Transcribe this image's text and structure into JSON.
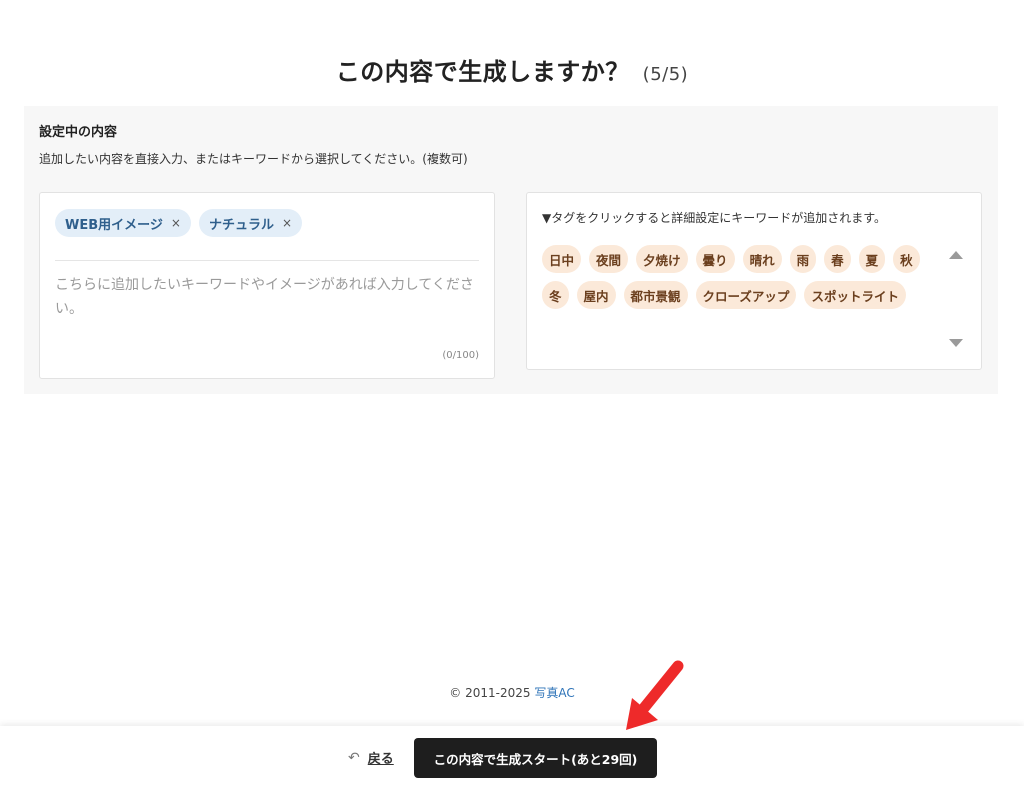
{
  "header": {
    "title": "この内容で生成しますか？",
    "step": "(5/5)"
  },
  "settings": {
    "section_title": "設定中の内容",
    "description": "追加したい内容を直接入力、またはキーワードから選択してください。(複数可)",
    "selected_chips": [
      {
        "label": "WEB用イメージ",
        "remove": "×"
      },
      {
        "label": "ナチュラル",
        "remove": "×"
      }
    ],
    "keyword_input": {
      "value": "",
      "placeholder": "こちらに追加したいキーワードやイメージがあれば入力してください。",
      "counter": "(0/100)"
    },
    "tag_hint": "▼タグをクリックすると詳細設定にキーワードが追加されます。",
    "tags": [
      "日中",
      "夜間",
      "夕焼け",
      "曇り",
      "晴れ",
      "雨",
      "春",
      "夏",
      "秋",
      "冬",
      "屋内",
      "都市景観",
      "クローズアップ",
      "スポットライト"
    ]
  },
  "footer": {
    "copyright_prefix": "© 2011-2025",
    "brand_link": "写真AC"
  },
  "actions": {
    "back_icon": "↶",
    "back_label": "戻る",
    "start_label": "この内容で生成スタート(あと29回)"
  },
  "colors": {
    "chip_bg": "#e3eef8",
    "tag_bg": "#fbe9d9",
    "button_bg": "#1e1e1e",
    "arrow": "#ee2a2a"
  }
}
